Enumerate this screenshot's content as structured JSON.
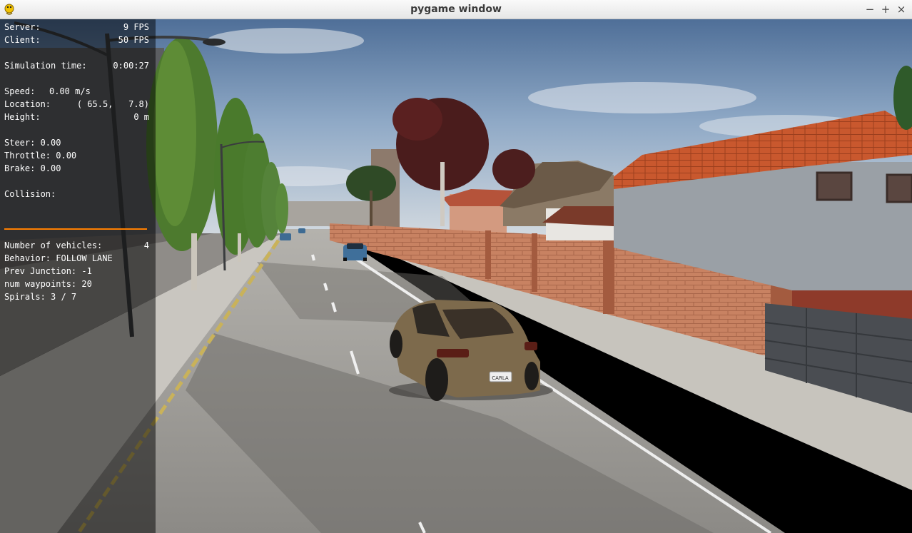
{
  "window": {
    "title": "pygame window",
    "controls": {
      "minimize": "−",
      "maximize": "+",
      "close": "×"
    },
    "icon": "python-snake-icon"
  },
  "hud": {
    "server_label": "Server:",
    "server_value": "9 FPS",
    "client_label": "Client:",
    "client_value": "50 FPS",
    "sim_time_label": "Simulation time:",
    "sim_time_value": "0:00:27",
    "speed_label": "Speed:",
    "speed_value": "0.00 m/s",
    "location_label": "Location:",
    "location_value": "( 65.5,   7.8)",
    "height_label": "Height:",
    "height_value": "0 m",
    "steer": "Steer: 0.00",
    "throttle": "Throttle: 0.00",
    "brake": "Brake: 0.00",
    "collision": "Collision:",
    "vehicles_label": "Number of vehicles:",
    "vehicles_value": "4",
    "behavior": "Behavior: FOLLOW LANE",
    "prev_junction": "Prev Junction: -1",
    "num_waypoints": "num waypoints: 20",
    "spirals": "Spirals: 3 / 7",
    "separator_color": "#ff8000"
  },
  "scene": {
    "license_plate": "CARLA"
  }
}
